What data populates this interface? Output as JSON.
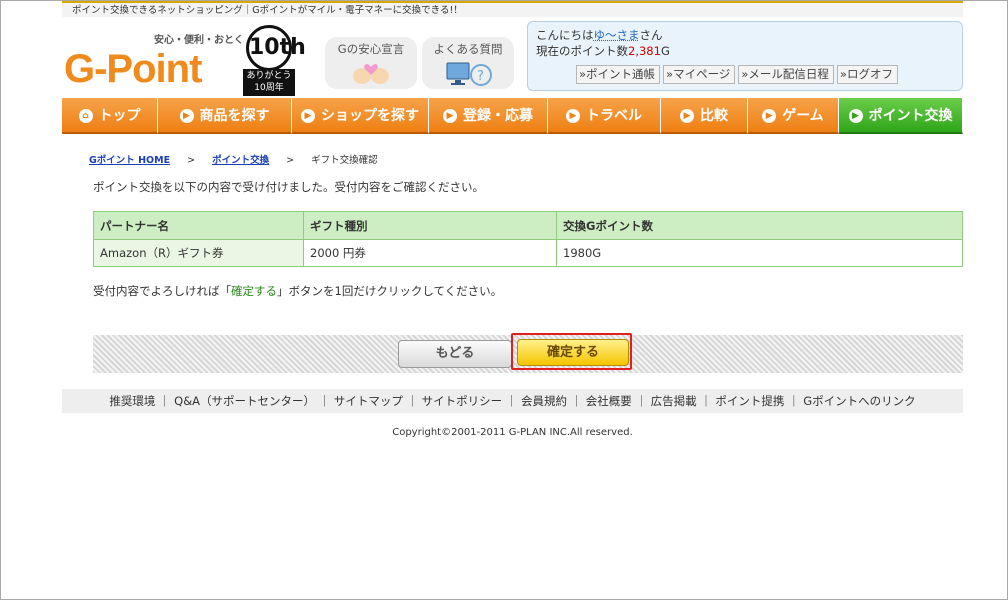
{
  "top_strip": "ポイント交換できるネットショッピング｜Gポイントがマイル・電子マネーに交換できる!！",
  "logo": {
    "tagline": "安心・便利・おとく",
    "brand": "G-Point",
    "badge_number": "10th",
    "badge_line1": "ありがとう",
    "badge_line2": "10周年"
  },
  "header_buttons": [
    {
      "label": "Gの安心宣言",
      "icon": "hands-heart-icon"
    },
    {
      "label": "よくある質問",
      "icon": "computer-question-icon"
    }
  ],
  "member": {
    "greeting_prefix": "こんにちは",
    "username": "ゆ〜さま",
    "greeting_suffix": "さん",
    "points_prefix": "現在のポイント数",
    "points_value": "2,381",
    "points_unit": "G",
    "links": [
      "»ポイント通帳",
      "»マイページ",
      "»メール配信日程",
      "»ログオフ"
    ]
  },
  "nav": [
    {
      "label": "トップ",
      "glyph": "⌂"
    },
    {
      "label": "商品を探す",
      "glyph": "▶"
    },
    {
      "label": "ショップを探す",
      "glyph": "▶"
    },
    {
      "label": "登録・応募",
      "glyph": "▶"
    },
    {
      "label": "トラベル",
      "glyph": "▶"
    },
    {
      "label": "比較",
      "glyph": "▶"
    },
    {
      "label": "ゲーム",
      "glyph": "▶"
    },
    {
      "label": "ポイント交換",
      "glyph": "▶"
    }
  ],
  "breadcrumb": {
    "home": "Gポイント HOME",
    "exchange": "ポイント交換",
    "current": "ギフト交換確認",
    "separator": ">"
  },
  "message_received": "ポイント交換を以下の内容で受け付けました。受付内容をご確認ください。",
  "table": {
    "headers": [
      "パートナー名",
      "ギフト種別",
      "交換Gポイント数"
    ],
    "rows": [
      [
        "Amazon（R）ギフト券",
        "2000 円券",
        "1980G"
      ]
    ]
  },
  "instruction": {
    "before": "受付内容でよろしければ「",
    "highlight": "確定する",
    "after": "」ボタンを1回だけクリックしてください。"
  },
  "buttons": {
    "back": "もどる",
    "confirm": "確定する"
  },
  "footer_links": [
    "推奨環境",
    "Q&A（サポートセンター）",
    "サイトマップ",
    "サイトポリシー",
    "会員規約",
    "会社概要",
    "広告掲載",
    "ポイント提携",
    "Gポイントへのリンク"
  ],
  "copyright": "Copyright©2001-2011 G-PLAN INC.All reserved."
}
